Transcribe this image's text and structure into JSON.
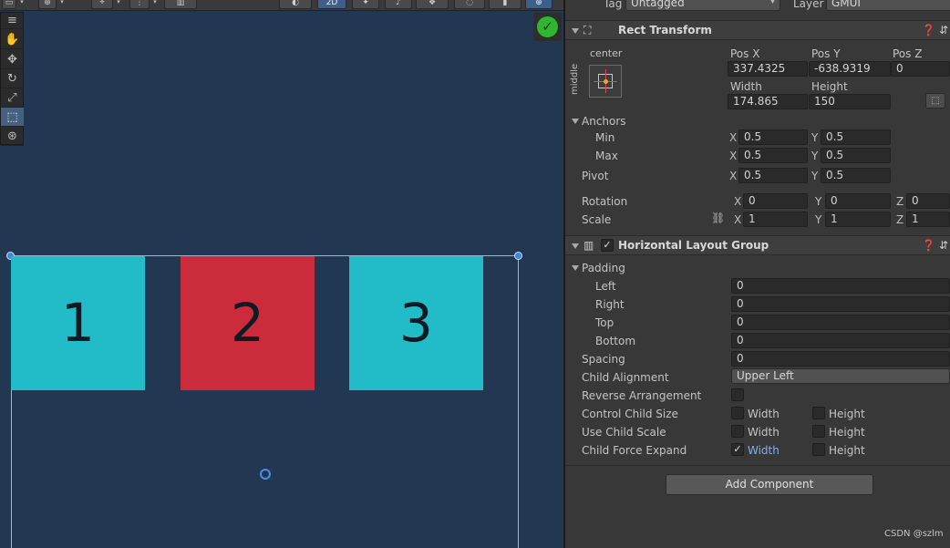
{
  "scene": {
    "toolbar": {
      "mode_2d": "2D"
    },
    "cells": [
      {
        "label": "1",
        "color": "#22bcc8"
      },
      {
        "label": "2",
        "color": "#cc2b3b"
      },
      {
        "label": "3",
        "color": "#22bcc8"
      }
    ],
    "tools": [
      "hand-tool",
      "move-tool",
      "rotate-tool",
      "scale-tool",
      "rect-tool",
      "transform-tool"
    ],
    "active_tool": "rect-tool",
    "status_check": "✓"
  },
  "inspector": {
    "tag_label": "Tag",
    "tag_value": "Untagged",
    "layer_label": "Layer",
    "layer_value": "GMUI",
    "rect_transform": {
      "title": "Rect Transform",
      "anchor_preset_top": "center",
      "anchor_preset_side": "middle",
      "pos_x_label": "Pos X",
      "pos_y_label": "Pos Y",
      "pos_z_label": "Pos Z",
      "pos_x": "337.4325",
      "pos_y": "-638.9319",
      "pos_z": "0",
      "width_label": "Width",
      "height_label": "Height",
      "width": "174.865",
      "height": "150",
      "anchors_label": "Anchors",
      "min_label": "Min",
      "max_label": "Max",
      "min_x": "0.5",
      "min_y": "0.5",
      "max_x": "0.5",
      "max_y": "0.5",
      "pivot_label": "Pivot",
      "pivot_x": "0.5",
      "pivot_y": "0.5",
      "rotation_label": "Rotation",
      "rot_x": "0",
      "rot_y": "0",
      "rot_z": "0",
      "scale_label": "Scale",
      "scale_x": "1",
      "scale_y": "1",
      "scale_z": "1",
      "axis_x": "X",
      "axis_y": "Y",
      "axis_z": "Z"
    },
    "layout_group": {
      "title": "Horizontal Layout Group",
      "padding_label": "Padding",
      "left_label": "Left",
      "left": "0",
      "right_label": "Right",
      "right": "0",
      "top_label": "Top",
      "top": "0",
      "bottom_label": "Bottom",
      "bottom": "0",
      "spacing_label": "Spacing",
      "spacing": "0",
      "child_alignment_label": "Child Alignment",
      "child_alignment": "Upper Left",
      "reverse_label": "Reverse Arrangement",
      "control_size_label": "Control Child Size",
      "use_scale_label": "Use Child Scale",
      "force_expand_label": "Child Force Expand",
      "width_opt": "Width",
      "height_opt": "Height"
    },
    "add_component": "Add Component",
    "watermark": "CSDN @szlm"
  }
}
